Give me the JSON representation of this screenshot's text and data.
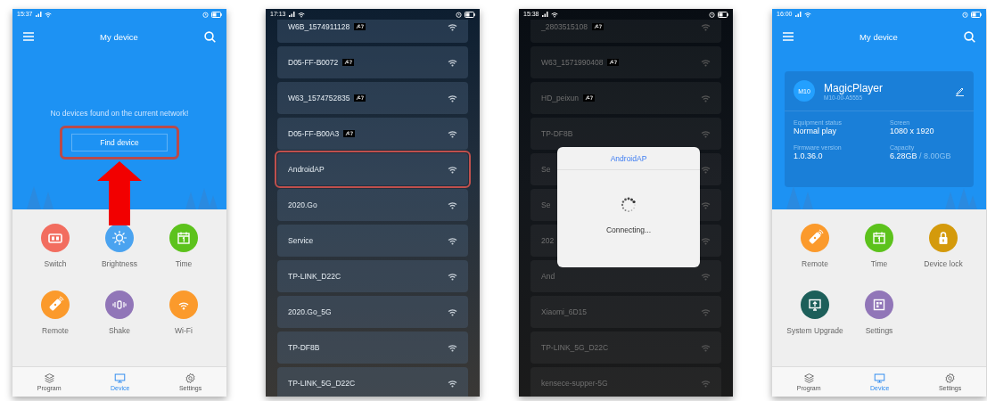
{
  "screens": [
    {
      "kind": "home",
      "status_time": "15:37",
      "title": "My device",
      "message": "No devices found on the current network!",
      "find_button": {
        "label": "Find device",
        "highlighted": true
      },
      "tools": [
        {
          "label": "Switch",
          "kind": "switch",
          "color": "#f26d5f"
        },
        {
          "label": "Brightness",
          "kind": "brightness",
          "color": "#4aa3f0"
        },
        {
          "label": "Time",
          "kind": "time",
          "color": "#5cc21c"
        },
        {
          "label": "Remote",
          "kind": "remote",
          "color": "#fb9a2c"
        },
        {
          "label": "Shake",
          "kind": "shake",
          "color": "#9176b8"
        },
        {
          "label": "Wi-Fi",
          "kind": "wifi",
          "color": "#fb9a2c"
        }
      ],
      "nav": [
        {
          "label": "Program",
          "kind": "program",
          "selected": false
        },
        {
          "label": "Device",
          "kind": "device",
          "selected": true
        },
        {
          "label": "Settings",
          "kind": "settings",
          "selected": false
        }
      ]
    },
    {
      "kind": "wifi_list",
      "status_time": "17:13",
      "dimmed": false,
      "networks": [
        {
          "name": "W6B_1574911128",
          "tagged": true,
          "highlighted": false
        },
        {
          "name": "D05-FF-B0072",
          "tagged": true,
          "highlighted": false
        },
        {
          "name": "W63_1574752835",
          "tagged": true,
          "highlighted": false
        },
        {
          "name": "D05-FF-B00A3",
          "tagged": true,
          "highlighted": false
        },
        {
          "name": "AndroidAP",
          "tagged": false,
          "highlighted": true
        },
        {
          "name": "2020.Go",
          "tagged": false,
          "highlighted": false
        },
        {
          "name": "Service",
          "tagged": false,
          "highlighted": false
        },
        {
          "name": "TP-LINK_D22C",
          "tagged": false,
          "highlighted": false
        },
        {
          "name": "2020.Go_5G",
          "tagged": false,
          "highlighted": false
        },
        {
          "name": "TP-DF8B",
          "tagged": false,
          "highlighted": false
        },
        {
          "name": "TP-LINK_5G_D22C",
          "tagged": false,
          "highlighted": false
        }
      ]
    },
    {
      "kind": "wifi_list",
      "status_time": "15:38",
      "dimmed": true,
      "networks": [
        {
          "name": "_2803515108",
          "tagged": true,
          "highlighted": false
        },
        {
          "name": "W63_1571990408",
          "tagged": true,
          "highlighted": false
        },
        {
          "name": "HD_peixun",
          "tagged": true,
          "highlighted": false
        },
        {
          "name": "TP-DF8B",
          "tagged": false,
          "highlighted": false
        },
        {
          "name": "Se",
          "tagged": false,
          "highlighted": false
        },
        {
          "name": "Se",
          "tagged": false,
          "highlighted": false
        },
        {
          "name": "202",
          "tagged": false,
          "highlighted": false
        },
        {
          "name": "And",
          "tagged": false,
          "highlighted": false
        },
        {
          "name": "Xiaomi_6D15",
          "tagged": false,
          "highlighted": false
        },
        {
          "name": "TP-LINK_5G_D22C",
          "tagged": false,
          "highlighted": false
        },
        {
          "name": "kensece-supper-5G",
          "tagged": false,
          "highlighted": false
        }
      ],
      "dialog": {
        "title": "AndroidAP",
        "message": "Connecting..."
      }
    },
    {
      "kind": "home",
      "status_time": "16:00",
      "title": "My device",
      "device_card": {
        "avatar": "M10",
        "name": "MagicPlayer",
        "serial": "M10-00-A5555",
        "stats": [
          {
            "label": "Equipment status",
            "value": "Normal play"
          },
          {
            "label": "Screen",
            "value": "1080 x 1920"
          },
          {
            "label": "Firmware version",
            "value": "1.0.36.0"
          },
          {
            "label": "Capacity",
            "value": "6.28GB",
            "total": " / 8.00GB"
          }
        ]
      },
      "tools": [
        {
          "label": "Remote",
          "kind": "remote",
          "color": "#fb9a2c"
        },
        {
          "label": "Time",
          "kind": "time",
          "color": "#5cc21c"
        },
        {
          "label": "Device lock",
          "kind": "lock",
          "color": "#d49a0c"
        },
        {
          "label": "System Upgrade",
          "kind": "upgrade",
          "color": "#1d5f5a"
        },
        {
          "label": "Settings",
          "kind": "settings",
          "color": "#9176b8"
        }
      ],
      "nav": [
        {
          "label": "Program",
          "kind": "program",
          "selected": false
        },
        {
          "label": "Device",
          "kind": "device",
          "selected": true
        },
        {
          "label": "Settings",
          "kind": "settings",
          "selected": false
        }
      ]
    }
  ]
}
